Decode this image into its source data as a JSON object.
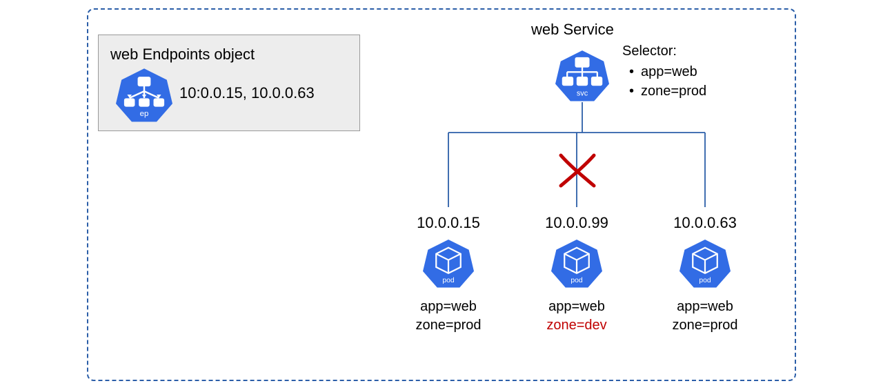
{
  "endpoints": {
    "title": "web Endpoints object",
    "ips": "10:0.0.15, 10.0.0.63",
    "icon_label": "ep"
  },
  "service": {
    "title": "web Service",
    "icon_label": "svc",
    "selector_header": "Selector:",
    "selector_items": [
      "app=web",
      "zone=prod"
    ]
  },
  "pods": [
    {
      "ip": "10.0.0.15",
      "label1": "app=web",
      "label2": "zone=prod",
      "label2_red": false,
      "icon_label": "pod"
    },
    {
      "ip": "10.0.0.99",
      "label1": "app=web",
      "label2": "zone=dev",
      "label2_red": true,
      "icon_label": "pod"
    },
    {
      "ip": "10.0.0.63",
      "label1": "app=web",
      "label2": "zone=prod",
      "label2_red": false,
      "icon_label": "pod"
    }
  ],
  "colors": {
    "k8s_blue": "#326ce5",
    "red": "#c00000",
    "line": "#2b5ea8"
  }
}
